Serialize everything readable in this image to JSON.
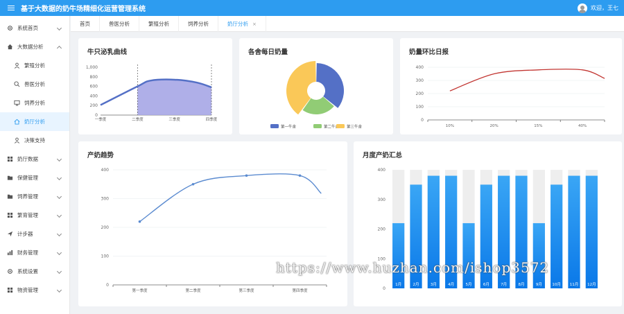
{
  "app_title": "基于大数据的奶牛场精细化运营管理系统",
  "user": {
    "greeting": "欢迎，王七"
  },
  "sidebar": {
    "items": [
      {
        "label": "系统首页",
        "icon": "gear-icon"
      },
      {
        "label": "大数据分析",
        "icon": "home-icon",
        "expanded": true
      },
      {
        "label": "繁殖分析",
        "icon": "person-icon",
        "sub": true
      },
      {
        "label": "兽医分析",
        "icon": "search-icon",
        "sub": true
      },
      {
        "label": "饲养分析",
        "icon": "monitor-icon",
        "sub": true
      },
      {
        "label": "奶厅分析",
        "icon": "house-icon",
        "sub": true,
        "active": true
      },
      {
        "label": "决策支持",
        "icon": "person-icon",
        "sub": true
      },
      {
        "label": "奶厅数据",
        "icon": "grid-icon"
      },
      {
        "label": "保健管理",
        "icon": "folder-icon"
      },
      {
        "label": "饲养管理",
        "icon": "folder-icon"
      },
      {
        "label": "繁育管理",
        "icon": "grid-icon"
      },
      {
        "label": "计步器",
        "icon": "send-icon"
      },
      {
        "label": "财务管理",
        "icon": "chart-icon"
      },
      {
        "label": "系统设置",
        "icon": "gear-icon"
      },
      {
        "label": "物资管理",
        "icon": "grid-icon"
      }
    ]
  },
  "tabs": [
    {
      "label": "首页"
    },
    {
      "label": "兽医分析"
    },
    {
      "label": "繁殖分析"
    },
    {
      "label": "饲养分析"
    },
    {
      "label": "奶厅分析",
      "active": true,
      "close": "×"
    }
  ],
  "charts": {
    "lactation": {
      "title": "牛只泌乳曲线"
    },
    "barn_milk": {
      "title": "各舍每日奶量"
    },
    "milk_ratio": {
      "title": "奶量环比日报"
    },
    "trend": {
      "title": "产奶趋势"
    },
    "monthly": {
      "title": "月度产奶汇总"
    }
  },
  "chart_data": [
    {
      "type": "area",
      "title": "牛只泌乳曲线",
      "categories": [
        "一季度",
        "二季度",
        "三季度",
        "四季度"
      ],
      "x": [
        0,
        1,
        1.35,
        2,
        2.6,
        3
      ],
      "values": [
        210,
        600,
        720,
        740,
        680,
        580
      ],
      "ylim": [
        0,
        1000
      ],
      "yticks": [
        "0",
        "200",
        "400",
        "600",
        "800",
        "1,000"
      ],
      "color": "#5470c6",
      "highlight_fill": "#a6a6e6"
    },
    {
      "type": "pie",
      "title": "各舍每日奶量",
      "series": [
        {
          "name": "第一牛舍",
          "value": 36,
          "color": "#5470c6"
        },
        {
          "name": "第二牛舍",
          "value": 24,
          "color": "#91cc75"
        },
        {
          "name": "第三牛舍",
          "value": 40,
          "color": "#fac858"
        }
      ]
    },
    {
      "type": "line",
      "title": "奶量环比日报",
      "categories": [
        "10%",
        "20%",
        "15%",
        "40%"
      ],
      "x": [
        0,
        1,
        2,
        3,
        3.5
      ],
      "values": [
        220,
        350,
        380,
        380,
        315
      ],
      "ylim": [
        0,
        400
      ],
      "yticks": [
        "0",
        "100",
        "200",
        "300",
        "400"
      ],
      "color": "#c23531"
    },
    {
      "type": "line",
      "title": "产奶趋势",
      "categories": [
        "第一季度",
        "第二季度",
        "第三季度",
        "第四季度"
      ],
      "x": [
        0,
        1,
        2,
        3,
        3.4
      ],
      "values": [
        220,
        350,
        380,
        380,
        318
      ],
      "ylim": [
        0,
        400
      ],
      "yticks": [
        "0",
        "100",
        "200",
        "300",
        "400"
      ],
      "color": "#5b8bd0"
    },
    {
      "type": "bar",
      "title": "月度产奶汇总",
      "categories": [
        "1月",
        "2月",
        "3月",
        "4月",
        "5月",
        "6月",
        "7月",
        "8月",
        "9月",
        "10月",
        "11月",
        "12月"
      ],
      "values": [
        220,
        350,
        380,
        380,
        220,
        350,
        380,
        380,
        220,
        350,
        380,
        380
      ],
      "ylim": [
        0,
        400
      ],
      "yticks": [
        "0",
        "100",
        "200",
        "300",
        "400"
      ],
      "bar_top_color": "#3aa6f5",
      "bar_bottom_color": "#0a78e8",
      "bar_bg_color": "#eeeeee"
    }
  ],
  "watermark": "https://www.huzhan.com/ishop3572"
}
